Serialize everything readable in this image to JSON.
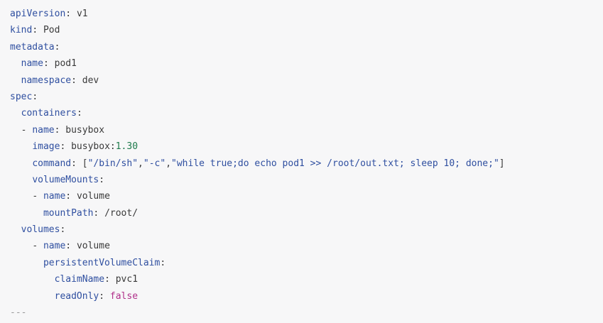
{
  "code": {
    "language": "yaml",
    "lines": [
      {
        "indent": "",
        "dash": "",
        "key": "apiVersion",
        "value": "v1",
        "value_type": "plain"
      },
      {
        "indent": "",
        "dash": "",
        "key": "kind",
        "value": "Pod",
        "value_type": "plain"
      },
      {
        "indent": "",
        "dash": "",
        "key": "metadata",
        "value": "",
        "value_type": "none"
      },
      {
        "indent": "  ",
        "dash": "",
        "key": "name",
        "value": "pod1",
        "value_type": "plain"
      },
      {
        "indent": "  ",
        "dash": "",
        "key": "namespace",
        "value": "dev",
        "value_type": "plain"
      },
      {
        "indent": "",
        "dash": "",
        "key": "spec",
        "value": "",
        "value_type": "none"
      },
      {
        "indent": "  ",
        "dash": "",
        "key": "containers",
        "value": "",
        "value_type": "none"
      },
      {
        "indent": "  ",
        "dash": "- ",
        "key": "name",
        "value": "busybox",
        "value_type": "plain"
      },
      {
        "indent": "    ",
        "dash": "",
        "key": "image",
        "value_prefix": "busybox:",
        "value": "1.30",
        "value_type": "number_suffix"
      },
      {
        "indent": "    ",
        "dash": "",
        "key": "command",
        "value_type": "array",
        "array": [
          "\"/bin/sh\"",
          "\"-c\"",
          "\"while true;do echo pod1 >> /root/out.txt; sleep 10; done;\""
        ]
      },
      {
        "indent": "    ",
        "dash": "",
        "key": "volumeMounts",
        "value": "",
        "value_type": "none"
      },
      {
        "indent": "    ",
        "dash": "- ",
        "key": "name",
        "value": "volume",
        "value_type": "plain"
      },
      {
        "indent": "      ",
        "dash": "",
        "key": "mountPath",
        "value": "/root/",
        "value_type": "plain"
      },
      {
        "indent": "  ",
        "dash": "",
        "key": "volumes",
        "value": "",
        "value_type": "none"
      },
      {
        "indent": "    ",
        "dash": "- ",
        "key": "name",
        "value": "volume",
        "value_type": "plain"
      },
      {
        "indent": "      ",
        "dash": "",
        "key": "persistentVolumeClaim",
        "value": "",
        "value_type": "none"
      },
      {
        "indent": "        ",
        "dash": "",
        "key": "claimName",
        "value": "pvc1",
        "value_type": "plain"
      },
      {
        "indent": "        ",
        "dash": "",
        "key": "readOnly",
        "value": "false",
        "value_type": "bool"
      },
      {
        "indent": "",
        "dash": "",
        "key": "",
        "value": "---",
        "value_type": "separator"
      }
    ]
  },
  "colors": {
    "background": "#f7f7f8",
    "key": "#2f4fa0",
    "text": "#3a3a3a",
    "number": "#1d7a4b",
    "string": "#2f4fa0",
    "boolean": "#b0308a",
    "separator": "#9a9a9a"
  }
}
